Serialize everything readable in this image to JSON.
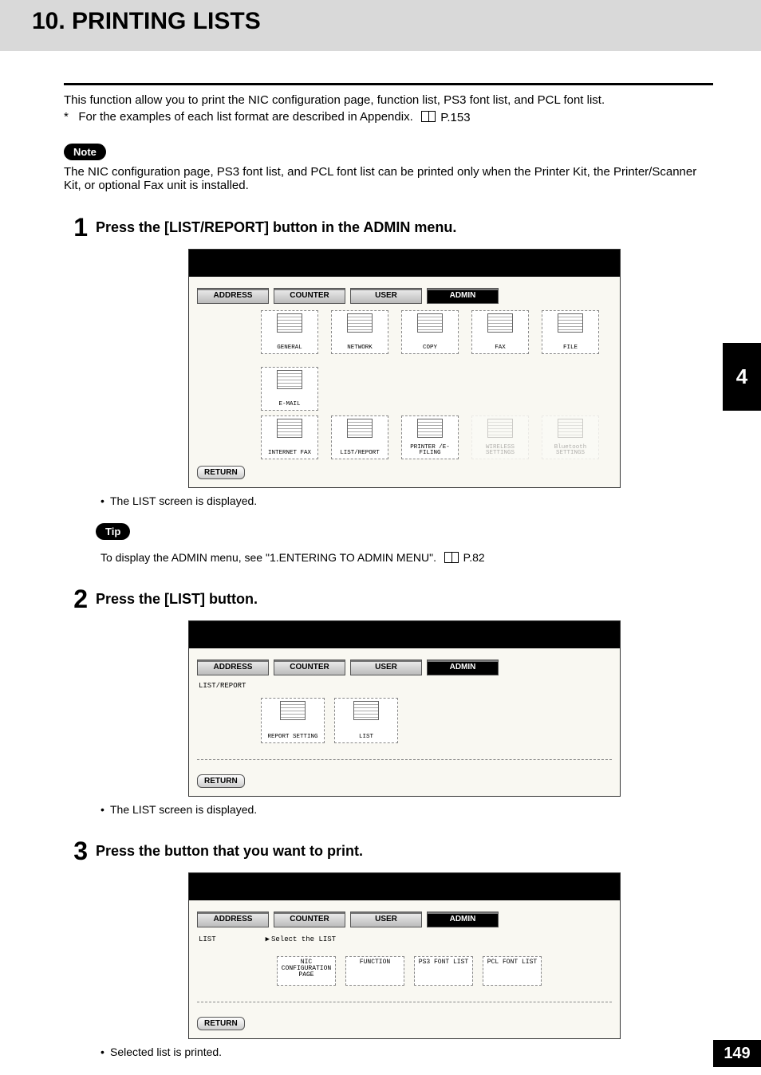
{
  "title": "10. PRINTING LISTS",
  "intro1": "This function allow you to print the NIC configuration page, function list, PS3 font list, and PCL font list.",
  "intro2_prefix": "*",
  "intro2": "For the examples of each list format are described in Appendix.",
  "intro2_ref": "P.153",
  "noteLabel": "Note",
  "noteBody": "The NIC configuration page, PS3 font list, and PCL font list can be printed only when the Printer Kit, the Printer/Scanner Kit, or optional Fax unit is installed.",
  "sideTab": "4",
  "pageNum": "149",
  "step1": {
    "num": "1",
    "title": "Press the [LIST/REPORT] button in the ADMIN menu.",
    "bullet": "The LIST screen is displayed.",
    "tipLabel": "Tip",
    "tipText": "To display the ADMIN menu, see \"1.ENTERING TO ADMIN MENU\".",
    "tipRef": "P.82",
    "tabs": [
      "ADDRESS",
      "COUNTER",
      "USER",
      "ADMIN"
    ],
    "row1": [
      "GENERAL",
      "NETWORK",
      "COPY",
      "FAX",
      "FILE",
      "E-MAIL"
    ],
    "row2": [
      "INTERNET FAX",
      "LIST/REPORT",
      "PRINTER /E-FILING",
      "WIRELESS SETTINGS",
      "Bluetooth SETTINGS"
    ],
    "returnLabel": "RETURN"
  },
  "step2": {
    "num": "2",
    "title": "Press the [LIST] button.",
    "bullet": "The LIST screen is displayed.",
    "tabs": [
      "ADDRESS",
      "COUNTER",
      "USER",
      "ADMIN"
    ],
    "sublabel": "LIST/REPORT",
    "btns": [
      "REPORT SETTING",
      "LIST"
    ],
    "returnLabel": "RETURN"
  },
  "step3": {
    "num": "3",
    "title": "Press the button that you want to print.",
    "bullet": "Selected list is printed.",
    "tabs": [
      "ADDRESS",
      "COUNTER",
      "USER",
      "ADMIN"
    ],
    "sublabel": "LIST",
    "prompt": "Select the LIST",
    "btns": [
      "NIC CONFIGURATION PAGE",
      "FUNCTION",
      "PS3 FONT LIST",
      "PCL FONT LIST"
    ],
    "returnLabel": "RETURN"
  }
}
